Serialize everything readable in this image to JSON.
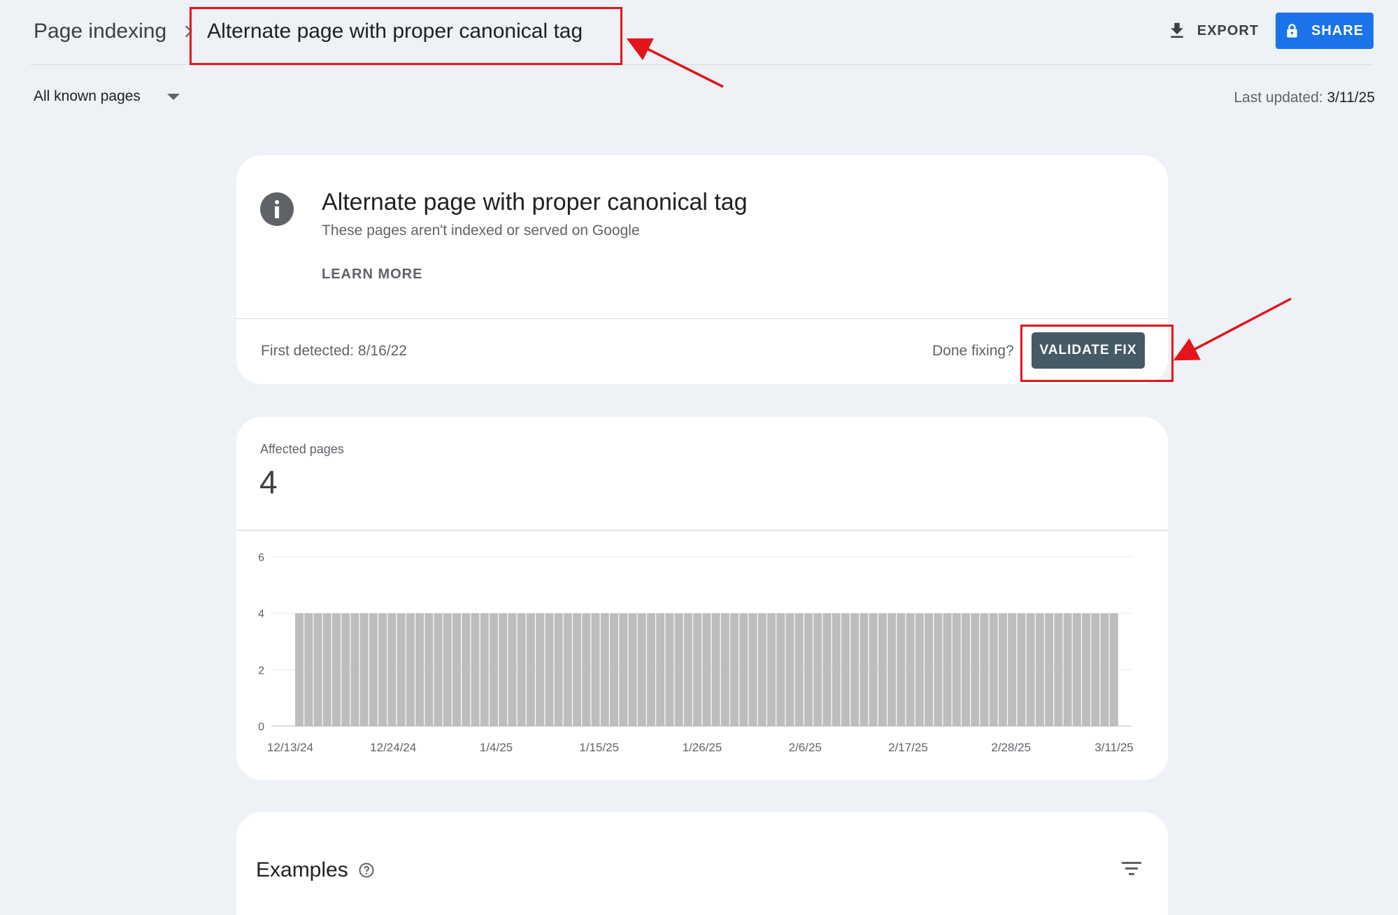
{
  "header": {
    "breadcrumb_parent": "Page indexing",
    "breadcrumb_current": "Alternate page with proper canonical tag",
    "export_label": "EXPORT",
    "share_label": "SHARE"
  },
  "filter": {
    "selected": "All known pages",
    "last_updated_label": "Last updated:",
    "last_updated_value": "3/11/25"
  },
  "issue_card": {
    "icon": "info-icon",
    "title": "Alternate page with proper canonical tag",
    "subtitle": "These pages aren't indexed or served on Google",
    "learn_more": "LEARN MORE",
    "first_detected": "First detected: 8/16/22",
    "done_fixing": "Done fixing?",
    "validate_button": "VALIDATE FIX"
  },
  "affected": {
    "label": "Affected pages",
    "count": "4"
  },
  "chart_data": {
    "type": "bar",
    "bar_color": "#bdbdbd",
    "ylim": [
      0,
      6
    ],
    "y_ticks": [
      "0",
      "2",
      "4",
      "6"
    ],
    "x_tick_labels": [
      "12/13/24",
      "12/24/24",
      "1/4/25",
      "1/15/25",
      "1/26/25",
      "2/6/25",
      "2/17/25",
      "2/28/25",
      "3/11/25"
    ],
    "x_start": "12/13/24",
    "x_end": "3/11/25",
    "daily_value": 4,
    "num_days": 89,
    "series": [
      {
        "values": [
          4,
          4,
          4,
          4,
          4,
          4,
          4,
          4,
          4,
          4,
          4,
          4,
          4,
          4,
          4,
          4,
          4,
          4,
          4,
          4,
          4,
          4,
          4,
          4,
          4,
          4,
          4,
          4,
          4,
          4,
          4,
          4,
          4,
          4,
          4,
          4,
          4,
          4,
          4,
          4,
          4,
          4,
          4,
          4,
          4,
          4,
          4,
          4,
          4,
          4,
          4,
          4,
          4,
          4,
          4,
          4,
          4,
          4,
          4,
          4,
          4,
          4,
          4,
          4,
          4,
          4,
          4,
          4,
          4,
          4,
          4,
          4,
          4,
          4,
          4,
          4,
          4,
          4,
          4,
          4,
          4,
          4,
          4,
          4,
          4,
          4,
          4,
          4,
          4
        ]
      }
    ]
  },
  "examples": {
    "title": "Examples"
  },
  "colors": {
    "background": "#eef2f7",
    "share_button": "#1a73e8",
    "validate_button": "#455a64",
    "annotation": "#e3151a"
  }
}
